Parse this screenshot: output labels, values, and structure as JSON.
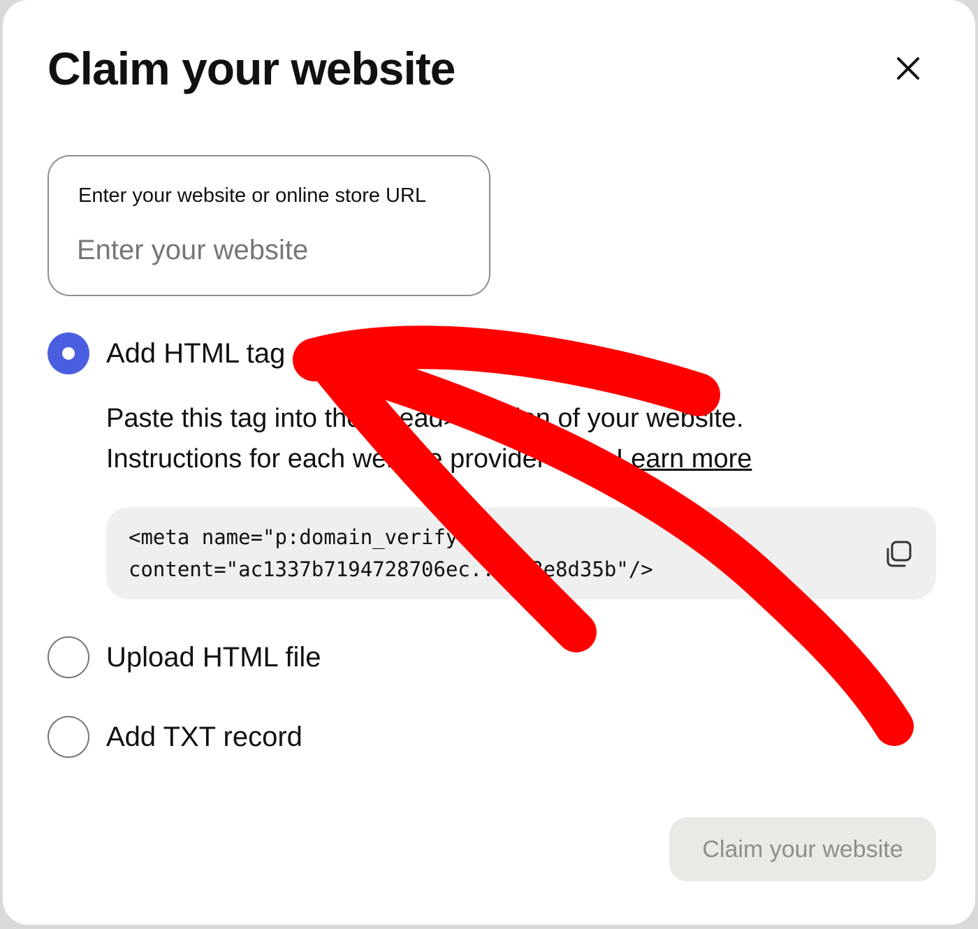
{
  "modal": {
    "title": "Claim your website",
    "close_icon": "close-icon"
  },
  "url_field": {
    "label": "Enter your website or online store URL",
    "placeholder": "Enter your website",
    "value": ""
  },
  "options": [
    {
      "label": "Add HTML tag",
      "selected": true,
      "instructions_line1": "Paste this tag into the <head> section of your website.",
      "instructions_line2": "Instructions for each website provider vary.",
      "learn_more": "Learn more",
      "code": "<meta name=\"p:domain_verify\"\ncontent=\"ac1337b7194728706ec...023e8d35b\"/>",
      "copy_icon": "copy-icon"
    },
    {
      "label": "Upload HTML file",
      "selected": false
    },
    {
      "label": "Add TXT record",
      "selected": false
    }
  ],
  "footer": {
    "submit_label": "Claim your website"
  },
  "colors": {
    "radio_selected": "#4a5fe0",
    "annotation_arrow": "#ff0000",
    "submit_disabled_bg": "#e9e9e5"
  }
}
